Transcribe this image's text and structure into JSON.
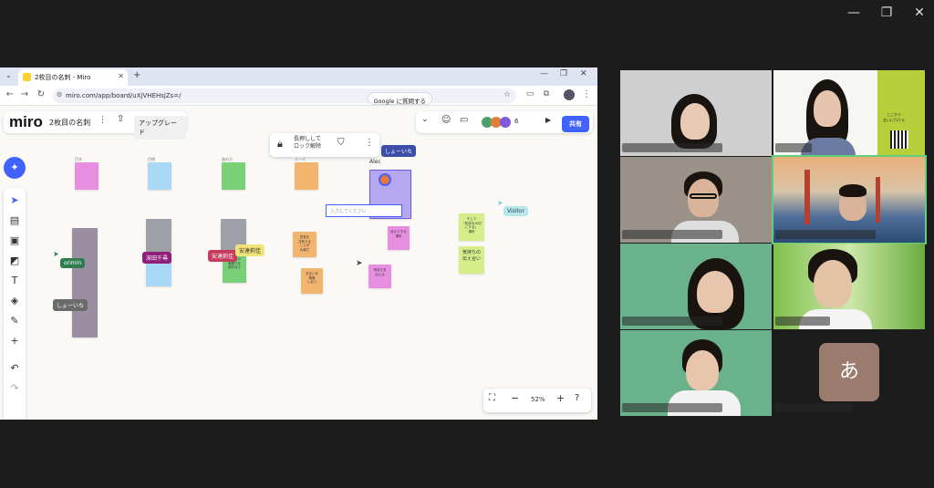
{
  "window_controls": {
    "minimize": "—",
    "restore": "❐",
    "close": "✕"
  },
  "browser": {
    "tab_title": "2枚目の名刺 - Miro",
    "new_tab": "+",
    "url": "miro.com/app/board/uXjVHEHsjZs=/",
    "google_btn": "Google に質問する"
  },
  "miro": {
    "logo": "miro",
    "board_name": "2枚目の名刺",
    "upgrade": "アップグレード",
    "share": "共有",
    "participant_count": "6",
    "context_bar": {
      "lock_label": "長押しして\nロック解除"
    },
    "zoom": "52%",
    "input_placeholder": "入力してください",
    "frame_labels": [
      "目次",
      "目標",
      "進め方",
      "ルール"
    ],
    "stickies": [
      {
        "text": "意見を\n共有する\nことが\n大事だ"
      },
      {
        "text": "笑顔で\nいる"
      },
      {
        "text": "気持ちの\n伝え合い"
      },
      {
        "text": "そして\n「相手を大切\nにする」\n場所"
      },
      {
        "text": "お互いの\n頑張りを\n認め合う"
      },
      {
        "text": "お互いを\n尊敬\nしあう"
      },
      {
        "text": "気持ちを\n伝える"
      },
      {
        "text": "安心できる\n場所"
      }
    ],
    "cursors": [
      {
        "name": "しょーいち",
        "color": "#3b4fa8"
      },
      {
        "name": "Alec",
        "color": ""
      },
      {
        "name": "Visitor",
        "color": "#7ad0d6"
      },
      {
        "name": "orimin",
        "color": "#2e7d4f"
      },
      {
        "name": "しょーいち",
        "color": "#5a5a5a"
      },
      {
        "name": "深田千尋",
        "color": "#8e1f7a"
      },
      {
        "name": "安達莉佳",
        "color": "#c63a5c"
      },
      {
        "name": "安達莉佳",
        "color": "#f2e27a"
      }
    ]
  },
  "video": {
    "avatar_letter": "あ",
    "poster_text": "ここから\n会いに行ける"
  }
}
